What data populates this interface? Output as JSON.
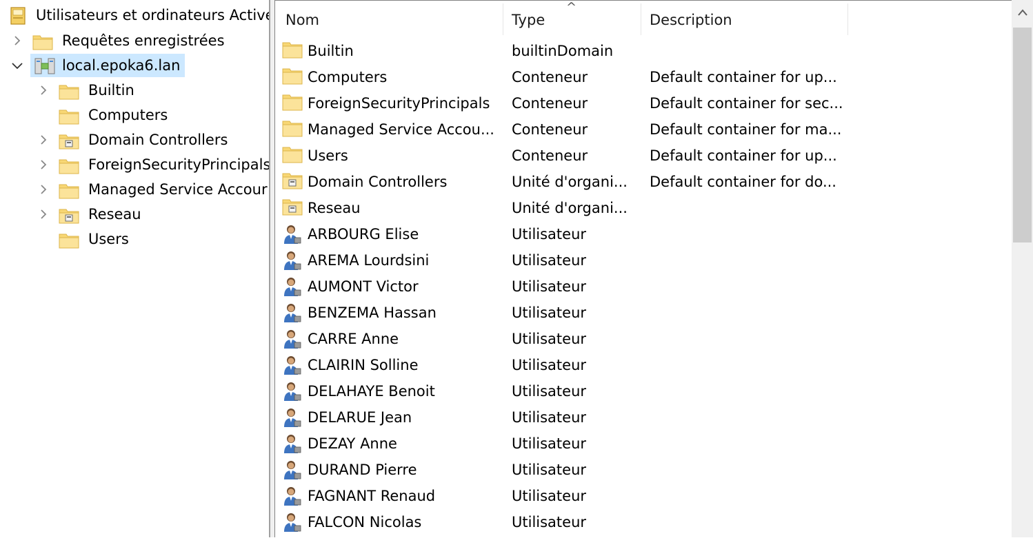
{
  "tree": {
    "root_label": "Utilisateurs et ordinateurs Active",
    "saved_queries_label": "Requêtes enregistrées",
    "domain_label": "local.epoka6.lan",
    "children": [
      {
        "label": "Builtin",
        "expandable": true,
        "icon": "folder"
      },
      {
        "label": "Computers",
        "expandable": false,
        "icon": "folder"
      },
      {
        "label": "Domain Controllers",
        "expandable": true,
        "icon": "ou-folder"
      },
      {
        "label": "ForeignSecurityPrincipals",
        "expandable": true,
        "icon": "folder"
      },
      {
        "label": "Managed Service Accour",
        "expandable": true,
        "icon": "folder"
      },
      {
        "label": "Reseau",
        "expandable": true,
        "icon": "ou-folder"
      },
      {
        "label": "Users",
        "expandable": false,
        "icon": "folder"
      }
    ]
  },
  "list": {
    "columns": {
      "name": "Nom",
      "type": "Type",
      "description": "Description"
    },
    "sort_indicator": "^",
    "rows": [
      {
        "icon": "folder",
        "name": "Builtin",
        "type": "builtinDomain",
        "description": ""
      },
      {
        "icon": "folder",
        "name": "Computers",
        "type": "Conteneur",
        "description": "Default container for up..."
      },
      {
        "icon": "folder",
        "name": "ForeignSecurityPrincipals",
        "type": "Conteneur",
        "description": "Default container for sec..."
      },
      {
        "icon": "folder",
        "name": "Managed Service Accou...",
        "type": "Conteneur",
        "description": "Default container for ma..."
      },
      {
        "icon": "folder",
        "name": "Users",
        "type": "Conteneur",
        "description": "Default container for up..."
      },
      {
        "icon": "ou-folder",
        "name": "Domain Controllers",
        "type": "Unité d'organi...",
        "description": "Default container for do..."
      },
      {
        "icon": "ou-folder",
        "name": "Reseau",
        "type": "Unité d'organi...",
        "description": ""
      },
      {
        "icon": "user",
        "name": "ARBOURG Elise",
        "type": "Utilisateur",
        "description": ""
      },
      {
        "icon": "user",
        "name": "AREMA Lourdsini",
        "type": "Utilisateur",
        "description": ""
      },
      {
        "icon": "user",
        "name": "AUMONT Victor",
        "type": "Utilisateur",
        "description": ""
      },
      {
        "icon": "user",
        "name": "BENZEMA Hassan",
        "type": "Utilisateur",
        "description": ""
      },
      {
        "icon": "user",
        "name": "CARRE Anne",
        "type": "Utilisateur",
        "description": ""
      },
      {
        "icon": "user",
        "name": "CLAIRIN Solline",
        "type": "Utilisateur",
        "description": ""
      },
      {
        "icon": "user",
        "name": "DELAHAYE Benoit",
        "type": "Utilisateur",
        "description": ""
      },
      {
        "icon": "user",
        "name": "DELARUE Jean",
        "type": "Utilisateur",
        "description": ""
      },
      {
        "icon": "user",
        "name": "DEZAY Anne",
        "type": "Utilisateur",
        "description": ""
      },
      {
        "icon": "user",
        "name": "DURAND Pierre",
        "type": "Utilisateur",
        "description": ""
      },
      {
        "icon": "user",
        "name": "FAGNANT Renaud",
        "type": "Utilisateur",
        "description": ""
      },
      {
        "icon": "user",
        "name": "FALCON Nicolas",
        "type": "Utilisateur",
        "description": ""
      }
    ]
  },
  "colors": {
    "selection": "#cce8ff",
    "folder_fill": "#f8d775",
    "folder_edge": "#dcb44a"
  }
}
